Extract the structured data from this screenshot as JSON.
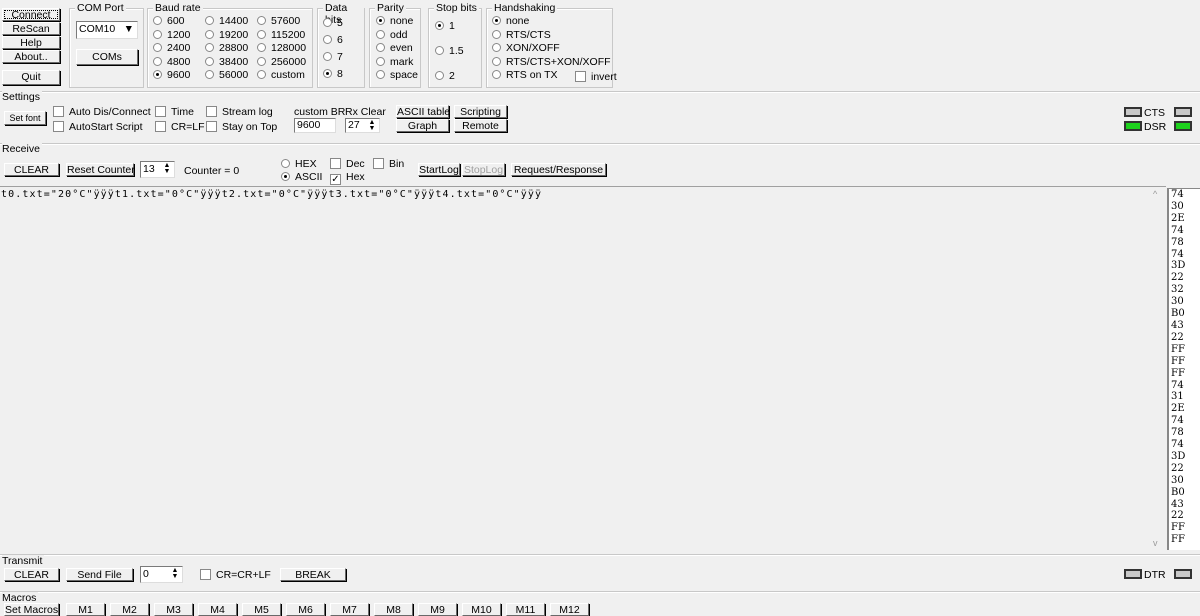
{
  "buttons": {
    "connect": "Connect",
    "rescan": "ReScan",
    "help": "Help",
    "about": "About..",
    "quit": "Quit"
  },
  "com_port": {
    "label": "COM Port",
    "value": "COM10",
    "coms": "COMs"
  },
  "baud": {
    "label": "Baud rate",
    "options": [
      "600",
      "1200",
      "2400",
      "4800",
      "9600",
      "14400",
      "19200",
      "28800",
      "38400",
      "56000",
      "57600",
      "115200",
      "128000",
      "256000",
      "custom"
    ],
    "selected": "9600"
  },
  "data_bits": {
    "label": "Data bits",
    "options": [
      "5",
      "6",
      "7",
      "8"
    ],
    "selected": "8"
  },
  "parity": {
    "label": "Parity",
    "options": [
      "none",
      "odd",
      "even",
      "mark",
      "space"
    ],
    "selected": "none"
  },
  "stop_bits": {
    "label": "Stop bits",
    "options": [
      "1",
      "1.5",
      "2"
    ],
    "selected": "1"
  },
  "handshaking": {
    "label": "Handshaking",
    "options": [
      "none",
      "RTS/CTS",
      "XON/XOFF",
      "RTS/CTS+XON/XOFF",
      "RTS on TX"
    ],
    "selected": "none",
    "invert": "invert"
  },
  "settings": {
    "label": "Settings",
    "set_font": "Set font",
    "auto_dis": "Auto Dis/Connect",
    "autostart": "AutoStart Script",
    "time": "Time",
    "crlf": "CR=LF",
    "stream_log": "Stream log",
    "stay_on_top": "Stay on Top",
    "custom_br_label": "custom BR",
    "custom_br": "9600",
    "rx_clear_label": "Rx Clear",
    "rx_clear": "27",
    "ascii_table": "ASCII table",
    "graph": "Graph",
    "scripting": "Scripting",
    "remote": "Remote"
  },
  "leds": {
    "cts": "CTS",
    "dsr": "DSR",
    "dtr": "DTR"
  },
  "receive": {
    "label": "Receive",
    "clear": "CLEAR",
    "reset_counter": "Reset Counter",
    "counter_spin": "13",
    "counter": "Counter = 0",
    "hex": "HEX",
    "ascii": "ASCII",
    "dec": "Dec",
    "hex_chk": "Hex",
    "bin": "Bin",
    "startlog": "StartLog",
    "stoplog": "StopLog",
    "reqresp": "Request/Response",
    "text": "t0.txt=\"20°C\"ÿÿÿt1.txt=\"0°C\"ÿÿÿt2.txt=\"0°C\"ÿÿÿt3.txt=\"0°C\"ÿÿÿt4.txt=\"0°C\"ÿÿÿ",
    "hex_values": [
      "74",
      "30",
      "2E",
      "74",
      "78",
      "74",
      "3D",
      "22",
      "32",
      "30",
      "B0",
      "43",
      "22",
      "FF",
      "FF",
      "FF",
      "74",
      "31",
      "2E",
      "74",
      "78",
      "74",
      "3D",
      "22",
      "30",
      "B0",
      "43",
      "22",
      "FF",
      "FF"
    ]
  },
  "transmit": {
    "label": "Transmit",
    "clear": "CLEAR",
    "send_file": "Send File",
    "spin": "0",
    "crcrlf": "CR=CR+LF",
    "break": "BREAK"
  },
  "macros": {
    "label": "Macros",
    "buttons": [
      "Set Macros",
      "M1",
      "M2",
      "M3",
      "M4",
      "M5",
      "M6",
      "M7",
      "M8",
      "M9",
      "M10",
      "M11",
      "M12"
    ]
  },
  "colors": {
    "led_on": "#1ed21e",
    "led_off": "#c8c8c8"
  }
}
